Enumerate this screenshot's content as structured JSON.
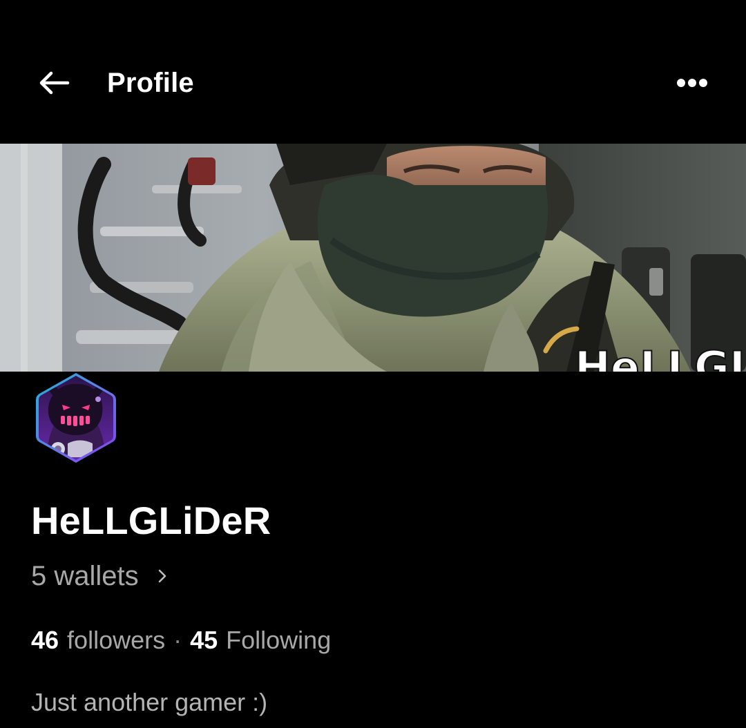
{
  "header": {
    "title": "Profile",
    "back_icon": "arrow-left-icon",
    "more_icon": "more-horizontal-icon"
  },
  "banner": {
    "overlay_text": "HeLLGL"
  },
  "profile": {
    "display_name": "HeLLGLiDeR",
    "wallets_label": "5 wallets",
    "followers_count": "46",
    "followers_label": "followers",
    "separator": "·",
    "following_count": "45",
    "following_label": "Following",
    "bio": "Just another gamer :)"
  },
  "colors": {
    "background": "#000000",
    "text_primary": "#ffffff",
    "text_secondary": "#a8a8a8",
    "avatar_border_start": "#1fb6d6",
    "avatar_border_end": "#8a3df0"
  }
}
